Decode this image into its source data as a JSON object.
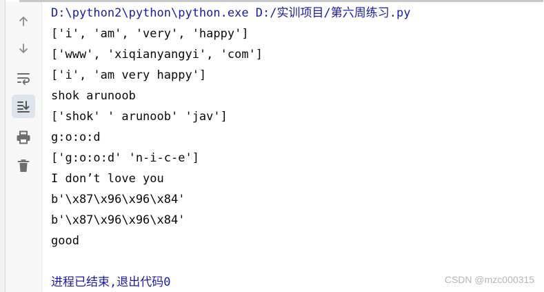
{
  "toolbar": {
    "buttons": [
      {
        "name": "up-arrow-icon"
      },
      {
        "name": "down-arrow-icon"
      },
      {
        "name": "soft-wrap-icon"
      },
      {
        "name": "scroll-to-end-icon",
        "active": true
      },
      {
        "name": "print-icon"
      },
      {
        "name": "trash-icon"
      }
    ]
  },
  "console": {
    "command": "D:\\python2\\python\\python.exe D:/实训项目/第六周练习.py",
    "output": [
      "['i', 'am', 'very', 'happy']",
      "['www', 'xiqianyangyi', 'com']",
      "['i', 'am very happy']",
      "shok arunoob",
      "['shok' ' arunoob' 'jav']",
      "g:o:o:d",
      "['g:o:o:d' 'n-i-c-e']",
      "I don’t love you",
      "b'\\x87\\x96\\x96\\x84'",
      "b'\\x87\\x96\\x96\\x84'",
      "good"
    ],
    "exit_message": "进程已结束,退出代码0"
  },
  "watermark": "CSDN @mzc000315",
  "colors": {
    "command_text": "#1a1aa6",
    "output_text": "#080808",
    "icon_gray": "#6e6e6e",
    "active_button_bg": "#dfe3ea"
  }
}
